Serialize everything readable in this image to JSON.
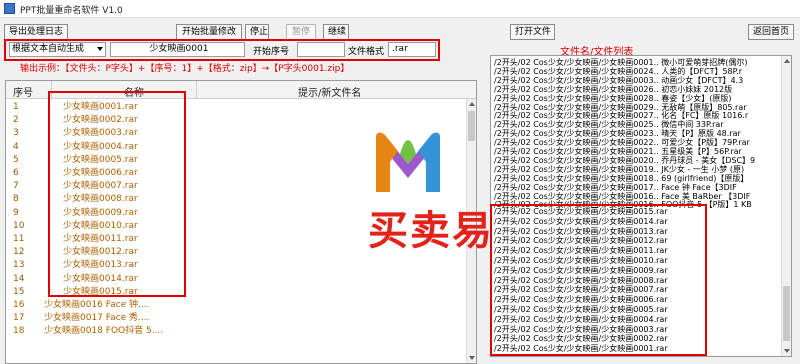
{
  "window": {
    "title": "PPT批量重命名软件 V1.0"
  },
  "toolbar": {
    "export_log": "导出处理日志",
    "start_rename": "开始批量修改",
    "stop": "停止",
    "pause": "暂停",
    "continue": "继续",
    "open_file": "打开文件",
    "back_home": "返回首页"
  },
  "options": {
    "mode": "根据文本自动生成",
    "name_value": "少女映画0001",
    "start_label": "开始序号",
    "start_value": "",
    "format_label": "文件格式",
    "format_value": ".rar"
  },
  "format_note": "输出示例：【文件头：P字头】+【序号：1】+【格式：zip】→【P字头0001.zip】",
  "table": {
    "col_num": "序号",
    "col_name": "名称",
    "col_note": "提示/新文件名",
    "rows": [
      {
        "num": "1",
        "name": "少女映画0001.rar"
      },
      {
        "num": "2",
        "name": "少女映画0002.rar"
      },
      {
        "num": "3",
        "name": "少女映画0003.rar"
      },
      {
        "num": "4",
        "name": "少女映画0004.rar"
      },
      {
        "num": "5",
        "name": "少女映画0005.rar"
      },
      {
        "num": "6",
        "name": "少女映画0006.rar"
      },
      {
        "num": "7",
        "name": "少女映画0007.rar"
      },
      {
        "num": "8",
        "name": "少女映画0008.rar"
      },
      {
        "num": "9",
        "name": "少女映画0009.rar"
      },
      {
        "num": "10",
        "name": "少女映画0010.rar"
      },
      {
        "num": "11",
        "name": "少女映画0011.rar"
      },
      {
        "num": "12",
        "name": "少女映画0012.rar"
      },
      {
        "num": "13",
        "name": "少女映画0013.rar"
      },
      {
        "num": "14",
        "name": "少女映画0014.rar"
      },
      {
        "num": "15",
        "name": "少女映画0015.rar"
      }
    ],
    "more_rows": [
      {
        "num": "16",
        "name": "少女映画0016 Face 钟...."
      },
      {
        "num": "17",
        "name": "少女映画0017 Face 秀...."
      },
      {
        "num": "18",
        "name": "少女映画0018 FOO抖音 5...."
      }
    ]
  },
  "file_list": {
    "title": "文件名/文件列表",
    "top_lines": [
      "/2开头/02 Cos少女/少女映画/少女映画0001..  微小可爱萌芽招牌(偶尔)",
      "/2开头/02 Cos少女/少女映画/少女映画0024..  人类的【DFCT】58P.r",
      "/2开头/02 Cos少女/少女映画/少女映画0003..  动画少女【DFCT】4.3",
      "/2开头/02 Cos少女/少女映画/少女映画0026..  初恋小妹妹 2012版",
      "/2开头/02 Cos少女/少女映画/少女映画0028..  春姿【少女】(原版)",
      "/2开头/02 Cos少女/少女映画/少女映画0029..  无敌萌【原版】805.rar",
      "/2开头/02 Cos少女/少女映画/少女映画0027..  化名【FC】原版 1016.r",
      "/2开头/02 Cos少女/少女映画/少女映画0025..  微信中间 33P.rar",
      "/2开头/02 Cos少女/少女映画/少女映画0023..  晴天【P】原版 48.rar",
      "/2开头/02 Cos少女/少女映画/少女映画0022..  可爱少女【P版】79P.rar",
      "/2开头/02 Cos少女/少女映画/少女映画0021..  五星级美【P】56P.rar",
      "/2开头/02 Cos少女/少女映画/少女映画0020..  乔丹球员 - 美女【DSC】9",
      "/2开头/02 Cos少女/少女映画/少女映画0019..  JK少女 - 一生 小梦 (原)",
      "/2开头/02 Cos少女/少女映画/少女映画0018..  69 (girlfriend)【原版】",
      "/2开头/02 Cos少女/少女映画/少女映画0017..  Face 钟  Face【3DIF",
      "/2开头/02 Cos少女/少女映画/少女映画0016..  Face 美 BaRber 【3DIF",
      "/2开头/02 Cos少女/少女映画/少女映画0016..  FOO抖音 5 【P版】1 KB"
    ],
    "bottom_lines": [
      "/2开头/02 Cos少女/少女映画/少女映画0015.rar",
      "/2开头/02 Cos少女/少女映画/少女映画0014.rar",
      "/2开头/02 Cos少女/少女映画/少女映画0013.rar",
      "/2开头/02 Cos少女/少女映画/少女映画0012.rar",
      "/2开头/02 Cos少女/少女映画/少女映画0011.rar",
      "/2开头/02 Cos少女/少女映画/少女映画0010.rar",
      "/2开头/02 Cos少女/少女映画/少女映画0009.rar",
      "/2开头/02 Cos少女/少女映画/少女映画0008.rar",
      "/2开头/02 Cos少女/少女映画/少女映画0007.rar",
      "/2开头/02 Cos少女/少女映画/少女映画0006.rar",
      "/2开头/02 Cos少女/少女映画/少女映画0005.rar",
      "/2开头/02 Cos少女/少女映画/少女映画0004.rar",
      "/2开头/02 Cos少女/少女映画/少女映画0003.rar",
      "/2开头/02 Cos少女/少女映画/少女映画0002.rar",
      "/2开头/02 Cos少女/少女映画/少女映画0001.rar"
    ]
  },
  "watermark": {
    "text": "买卖易"
  },
  "colors": {
    "highlight": "#e00000",
    "brand_red": "#e2231a",
    "brand_orange": "#f08a00",
    "brand_green": "#6dbf3a",
    "brand_purple": "#8a3cc2",
    "brand_blue": "#2a9ad8"
  }
}
